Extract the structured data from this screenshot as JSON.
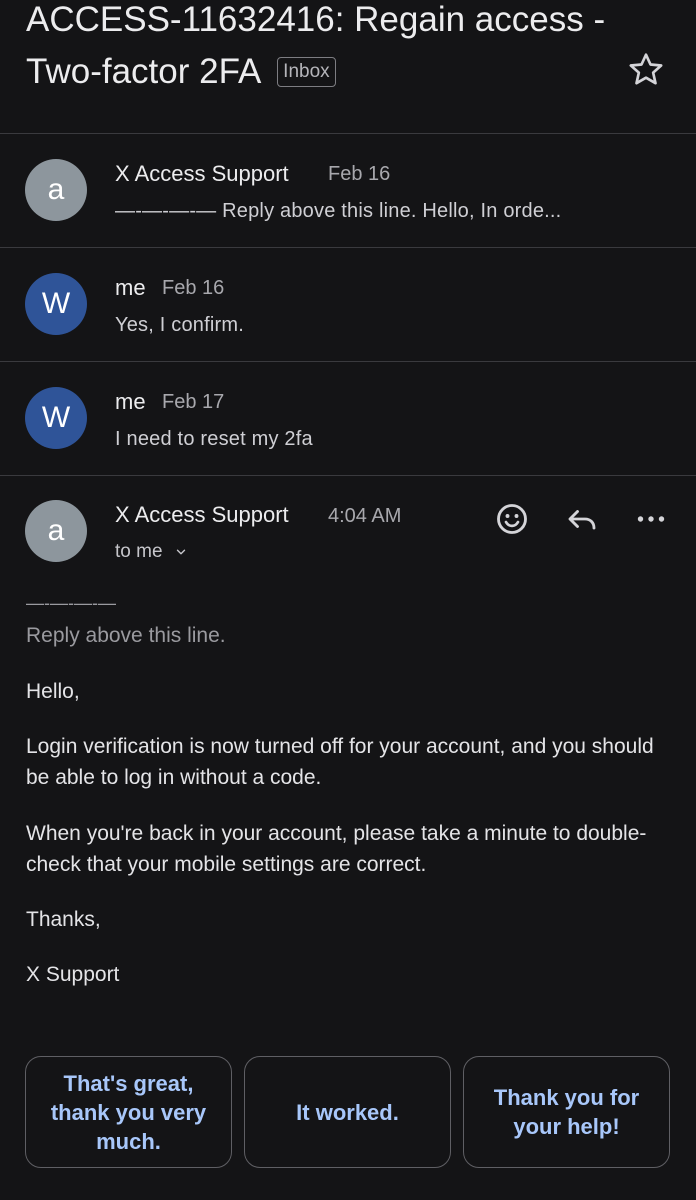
{
  "subject": {
    "title": "ACCESS-11632416: Regain access - Two-factor 2FA",
    "label_chip": "Inbox"
  },
  "icons": {
    "star": "star-icon",
    "emoji": "emoji-icon",
    "reply": "reply-icon",
    "more": "more-icon",
    "expand": "chevron-down-icon"
  },
  "colors": {
    "background": "#141416",
    "avatar_gray": "#8d969d",
    "avatar_blue": "#2f5498",
    "smart_reply_text": "#a8c7fa"
  },
  "thread": [
    {
      "avatar": "a",
      "sender": "X Access Support",
      "date": "Feb 16",
      "snippet": "—-—-—-— Reply above this line. Hello, In orde..."
    },
    {
      "avatar": "W",
      "sender": "me",
      "date": "Feb 16",
      "snippet": "Yes, I confirm."
    },
    {
      "avatar": "W",
      "sender": "me",
      "date": "Feb 17",
      "snippet": "I need to reset my 2fa"
    }
  ],
  "open_message": {
    "avatar": "a",
    "sender": "X Access Support",
    "time": "4:04 AM",
    "recipient": "to me",
    "separator": "—-—-—-—",
    "reply_line": "Reply above this line.",
    "greeting": "Hello,",
    "paragraph1": "Login verification is now turned off for your account, and you should be able to log in without a code.",
    "paragraph2": "When you're back in your account, please take a minute to double-check that your mobile settings are correct.",
    "closing": "Thanks,",
    "signature": "X Support"
  },
  "smart_replies": [
    "That's great, thank you very much.",
    "It worked.",
    "Thank you for your help!"
  ]
}
